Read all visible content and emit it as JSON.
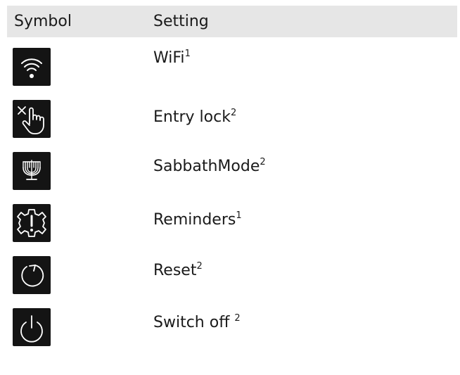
{
  "table": {
    "header": {
      "symbol": "Symbol",
      "setting": "Setting"
    },
    "rows": [
      {
        "icon": "wifi-icon",
        "label": "WiFi",
        "footnote": "1"
      },
      {
        "icon": "entry-lock-icon",
        "label": "Entry lock",
        "footnote": "2"
      },
      {
        "icon": "menorah-icon",
        "label": "SabbathMode",
        "footnote": "2"
      },
      {
        "icon": "reminder-gear-icon",
        "label": "Reminders",
        "footnote": "1"
      },
      {
        "icon": "reset-icon",
        "label": "Reset",
        "footnote": "2"
      },
      {
        "icon": "power-icon",
        "label": "Switch off ",
        "footnote": "2"
      }
    ]
  },
  "colors": {
    "header_background": "#e6e6e6",
    "icon_background": "#141414",
    "icon_foreground": "#ffffff",
    "text": "#1a1a1a"
  }
}
